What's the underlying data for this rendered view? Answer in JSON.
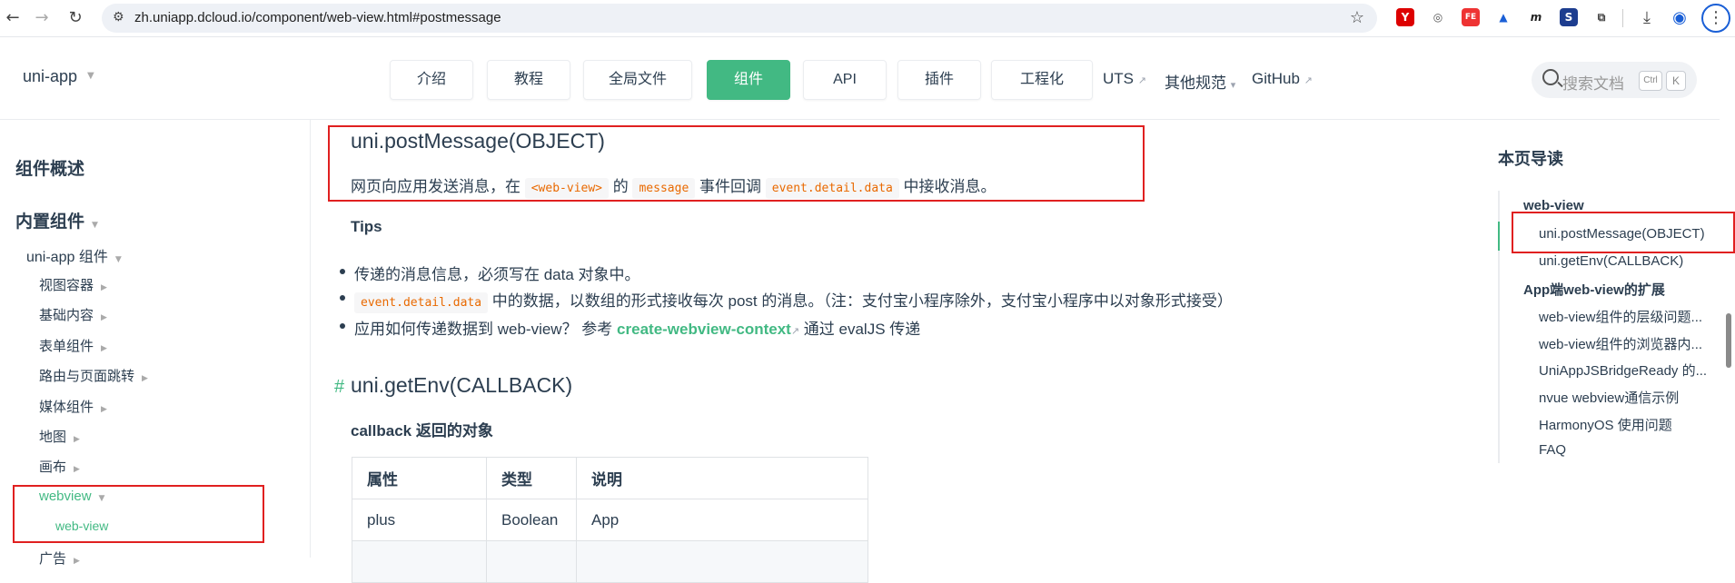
{
  "browser": {
    "url": "zh.uniapp.dcloud.io/component/web-view.html#postmessage",
    "ext_icons": [
      "Y",
      "◎",
      "FE",
      "▲",
      "m",
      "S",
      "⧉"
    ]
  },
  "header": {
    "brand": "uni-app",
    "nav": [
      "介绍",
      "教程",
      "全局文件",
      "组件",
      "API",
      "插件",
      "工程化"
    ],
    "links": [
      "UTS",
      "其他规范",
      "GitHub"
    ],
    "search_placeholder": "搜索文档",
    "kbd1": "Ctrl",
    "kbd2": "K"
  },
  "sidebar": {
    "title1": "组件概述",
    "title2": "内置组件",
    "group": "uni-app 组件",
    "items": [
      "视图容器",
      "基础内容",
      "表单组件",
      "路由与页面跳转",
      "媒体组件",
      "地图",
      "画布"
    ],
    "webview": "webview",
    "webview_child": "web-view",
    "next": "广告"
  },
  "main": {
    "postmessage_title": "uni.postMessage(OBJECT)",
    "desc_1": "网页向应用发送消息，在",
    "code_webview": "<web-view>",
    "desc_2": "的",
    "code_message": "message",
    "desc_3": "事件回调",
    "code_event": "event.detail.data",
    "desc_4": "中接收消息。",
    "tips": "Tips",
    "tip1": "传递的消息信息，必须写在 data 对象中。",
    "tip2_code": "event.detail.data",
    "tip2_text": "中的数据，以数组的形式接收每次 post 的消息。（注：支付宝小程序除外，支付宝小程序中以对象形式接受）",
    "tip3_a": "应用如何传递数据到 web-view？ 参考",
    "tip3_link": "create-webview-context",
    "tip3_b": "通过 evalJS 传递",
    "hash": "#",
    "getenv_title": "uni.getEnv(CALLBACK)",
    "callback_title": "callback 返回的对象",
    "table": {
      "headers": [
        "属性",
        "类型",
        "说明"
      ],
      "rows": [
        [
          "plus",
          "Boolean",
          "App"
        ]
      ]
    }
  },
  "toc": {
    "title": "本页导读",
    "items": [
      "web-view",
      "uni.postMessage(OBJECT)",
      "uni.getEnv(CALLBACK)",
      "App端web-view的扩展",
      "web-view组件的层级问题...",
      "web-view组件的浏览器内...",
      "UniAppJSBridgeReady 的...",
      "nvue webview通信示例",
      "HarmonyOS 使用问题",
      "FAQ"
    ]
  },
  "colors": {
    "accent": "#42b983",
    "annotation": "#e02020",
    "code": "#e96900"
  }
}
